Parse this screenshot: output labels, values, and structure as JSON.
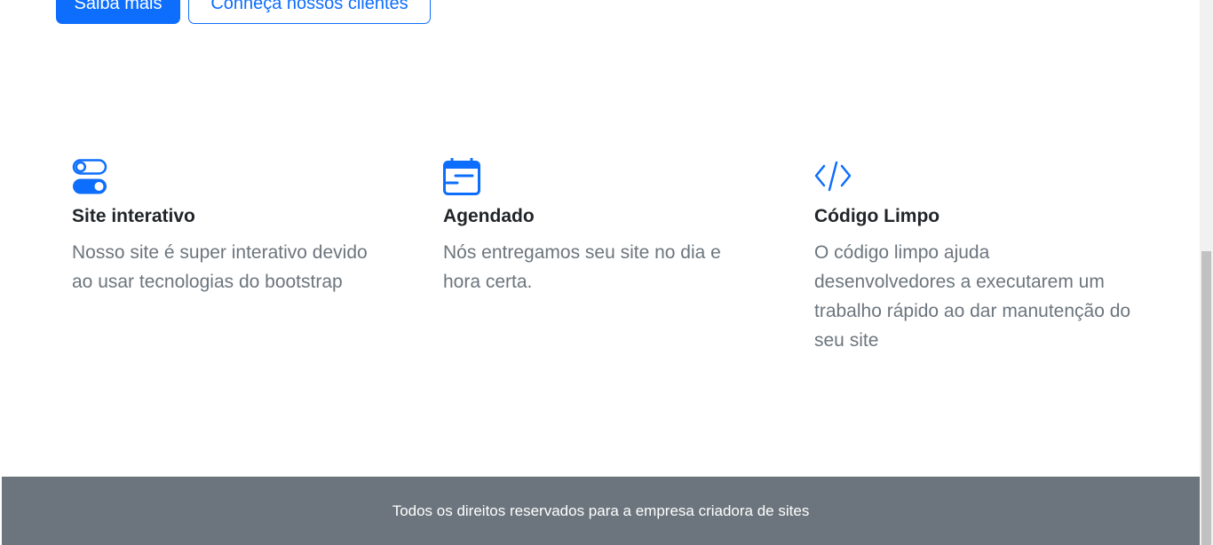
{
  "hero": {
    "primary_button": "Saiba mais",
    "secondary_button": "Conheça nossos clientes"
  },
  "features": [
    {
      "icon": "toggles-icon",
      "title": "Site interativo",
      "text": "Nosso site é super interativo devido ao usar tecnologias do bootstrap"
    },
    {
      "icon": "calendar-icon",
      "title": "Agendado",
      "text": "Nós entregamos seu site no dia e hora certa."
    },
    {
      "icon": "code-icon",
      "title": "Código Limpo",
      "text": "O código limpo ajuda desenvolvedores a executarem um trabalho rápido ao dar manutenção do seu site"
    }
  ],
  "footer": {
    "text": "Todos os direitos reservados para a empresa criadora de sites"
  },
  "colors": {
    "primary": "#0d6efd",
    "muted": "#6c757d",
    "heading": "#212529",
    "footer_bg": "#6c757d"
  }
}
